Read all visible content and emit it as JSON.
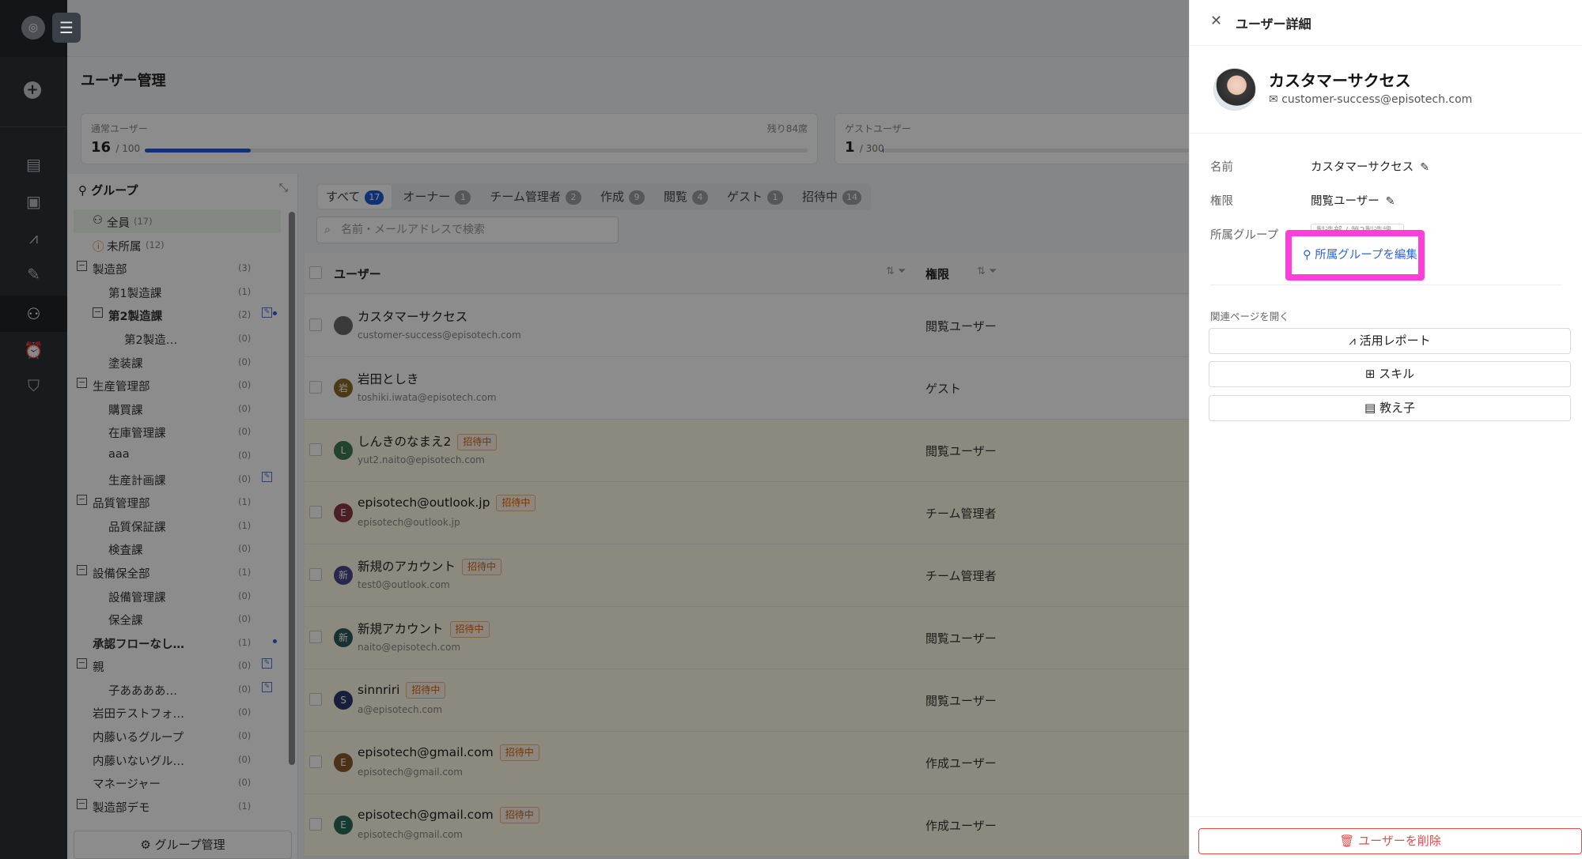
{
  "header": {
    "page_title": "ユーザー管理"
  },
  "quota": {
    "regular": {
      "label": "通常ユーザー",
      "count": "16",
      "max": "/ 100",
      "remaining": "残り84席",
      "progress": 0.16
    },
    "guest": {
      "label": "ゲストユーザー",
      "count": "1",
      "max": "/ 300",
      "progress": 0.003
    }
  },
  "groups": {
    "title": "グループ",
    "manage_label": "グループ管理",
    "tree": [
      {
        "label": "全員",
        "count": "(17)",
        "level": 0,
        "icon": "users",
        "selected": true
      },
      {
        "label": "未所属",
        "count": "(12)",
        "level": 0,
        "icon": "warn"
      },
      {
        "label": "製造部",
        "count": "(3)",
        "level": 0,
        "toggle": "−"
      },
      {
        "label": "第1製造課",
        "count": "(1)",
        "level": 1
      },
      {
        "label": "第2製造課",
        "count": "(2)",
        "level": 1,
        "toggle": "−",
        "bold": true,
        "edit": true,
        "dot": true
      },
      {
        "label": "第2製造…",
        "count": "(0)",
        "level": 2
      },
      {
        "label": "塗装課",
        "count": "(0)",
        "level": 1
      },
      {
        "label": "生産管理部",
        "count": "(0)",
        "level": 0,
        "toggle": "−"
      },
      {
        "label": "購買課",
        "count": "(0)",
        "level": 1
      },
      {
        "label": "在庫管理課",
        "count": "(0)",
        "level": 1
      },
      {
        "label": "aaa",
        "count": "(0)",
        "level": 1
      },
      {
        "label": "生産計画課",
        "count": "(0)",
        "level": 1,
        "edit": true
      },
      {
        "label": "品質管理部",
        "count": "(1)",
        "level": 0,
        "toggle": "−"
      },
      {
        "label": "品質保証課",
        "count": "(1)",
        "level": 1
      },
      {
        "label": "検査課",
        "count": "(0)",
        "level": 1
      },
      {
        "label": "設備保全部",
        "count": "(1)",
        "level": 0,
        "toggle": "−"
      },
      {
        "label": "設備管理課",
        "count": "(0)",
        "level": 1
      },
      {
        "label": "保全課",
        "count": "(0)",
        "level": 1
      },
      {
        "label": "承認フローなし…",
        "count": "(1)",
        "level": 0,
        "bold": true,
        "dot": true
      },
      {
        "label": "親",
        "count": "(0)",
        "level": 0,
        "toggle": "−",
        "edit": true
      },
      {
        "label": "子ああああ…",
        "count": "(0)",
        "level": 1,
        "edit": true
      },
      {
        "label": "岩田テストフォ…",
        "count": "(0)",
        "level": 0
      },
      {
        "label": "内藤いるグループ",
        "count": "(0)",
        "level": 0
      },
      {
        "label": "内藤いないグル…",
        "count": "(0)",
        "level": 0
      },
      {
        "label": "マネージャー",
        "count": "(0)",
        "level": 0
      },
      {
        "label": "製造部デモ",
        "count": "(1)",
        "level": 0,
        "toggle": "−"
      }
    ]
  },
  "tabs": [
    {
      "label": "すべて",
      "count": "17",
      "active": true
    },
    {
      "label": "オーナー",
      "count": "1"
    },
    {
      "label": "チーム管理者",
      "count": "2"
    },
    {
      "label": "作成",
      "count": "9"
    },
    {
      "label": "閲覧",
      "count": "4"
    },
    {
      "label": "ゲスト",
      "count": "1"
    },
    {
      "label": "招待中",
      "count": "14"
    }
  ],
  "search": {
    "placeholder": "名前・メールアドレスで検索"
  },
  "table": {
    "col_user": "ユーザー",
    "col_perm": "権限",
    "rows": [
      {
        "name": "カスタマーサクセス",
        "email": "customer-success@episotech.com",
        "perm": "閲覧ユーザー",
        "avatar": "",
        "avatar_color": "#6b6b6b",
        "invited": false
      },
      {
        "name": "岩田としき",
        "email": "toshiki.iwata@episotech.com",
        "perm": "ゲスト",
        "avatar": "岩",
        "avatar_color": "#8a6a2a",
        "invited": false
      },
      {
        "name": "しんきのなまえ2",
        "email": "yut2.naito@episotech.com",
        "perm": "閲覧ユーザー",
        "avatar": "L",
        "avatar_color": "#3f7a55",
        "invited": true
      },
      {
        "name": "episotech@outlook.jp",
        "email": "episotech@outlook.jp",
        "perm": "チーム管理者",
        "avatar": "E",
        "avatar_color": "#8a3a4a",
        "invited": true
      },
      {
        "name": "新規のアカウント",
        "email": "test0@outlook.com",
        "perm": "チーム管理者",
        "avatar": "新",
        "avatar_color": "#4a4a8a",
        "invited": true
      },
      {
        "name": "新規アカウント",
        "email": "naito@episotech.com",
        "perm": "閲覧ユーザー",
        "avatar": "新",
        "avatar_color": "#2d5a5a",
        "invited": true
      },
      {
        "name": "sinnriri",
        "email": "a@episotech.com",
        "perm": "閲覧ユーザー",
        "avatar": "S",
        "avatar_color": "#2a3a6a",
        "invited": true
      },
      {
        "name": "episotech@gmail.com",
        "email": "episotech@gmail.com",
        "perm": "作成ユーザー",
        "avatar": "E",
        "avatar_color": "#8a5a2a",
        "invited": true
      },
      {
        "name": "episotech@gmail.com",
        "email": "episotech@gmail.com",
        "perm": "作成ユーザー",
        "avatar": "E",
        "avatar_color": "#2a6a5a",
        "invited": true
      }
    ],
    "invited_tag": "招待中"
  },
  "drawer": {
    "title": "ユーザー詳細",
    "name": "カスタマーサクセス",
    "email": "customer-success@episotech.com",
    "field_name_label": "名前",
    "field_name_value": "カスタマーサクセス",
    "field_perm_label": "権限",
    "field_perm_value": "閲覧ユーザー",
    "field_group_label": "所属グループ",
    "group_chip": "製造部 / 第2製造課",
    "edit_group_label": "所属グループを編集",
    "related_label": "関連ページを開く",
    "related": [
      "活用レポート",
      "スキル",
      "教え子"
    ],
    "delete_label": "ユーザーを削除"
  },
  "colors": {
    "accent": "#1e5bd6",
    "highlight": "#ff3ed9",
    "danger": "#e84a4a",
    "invited_tag": "#d4650b"
  }
}
